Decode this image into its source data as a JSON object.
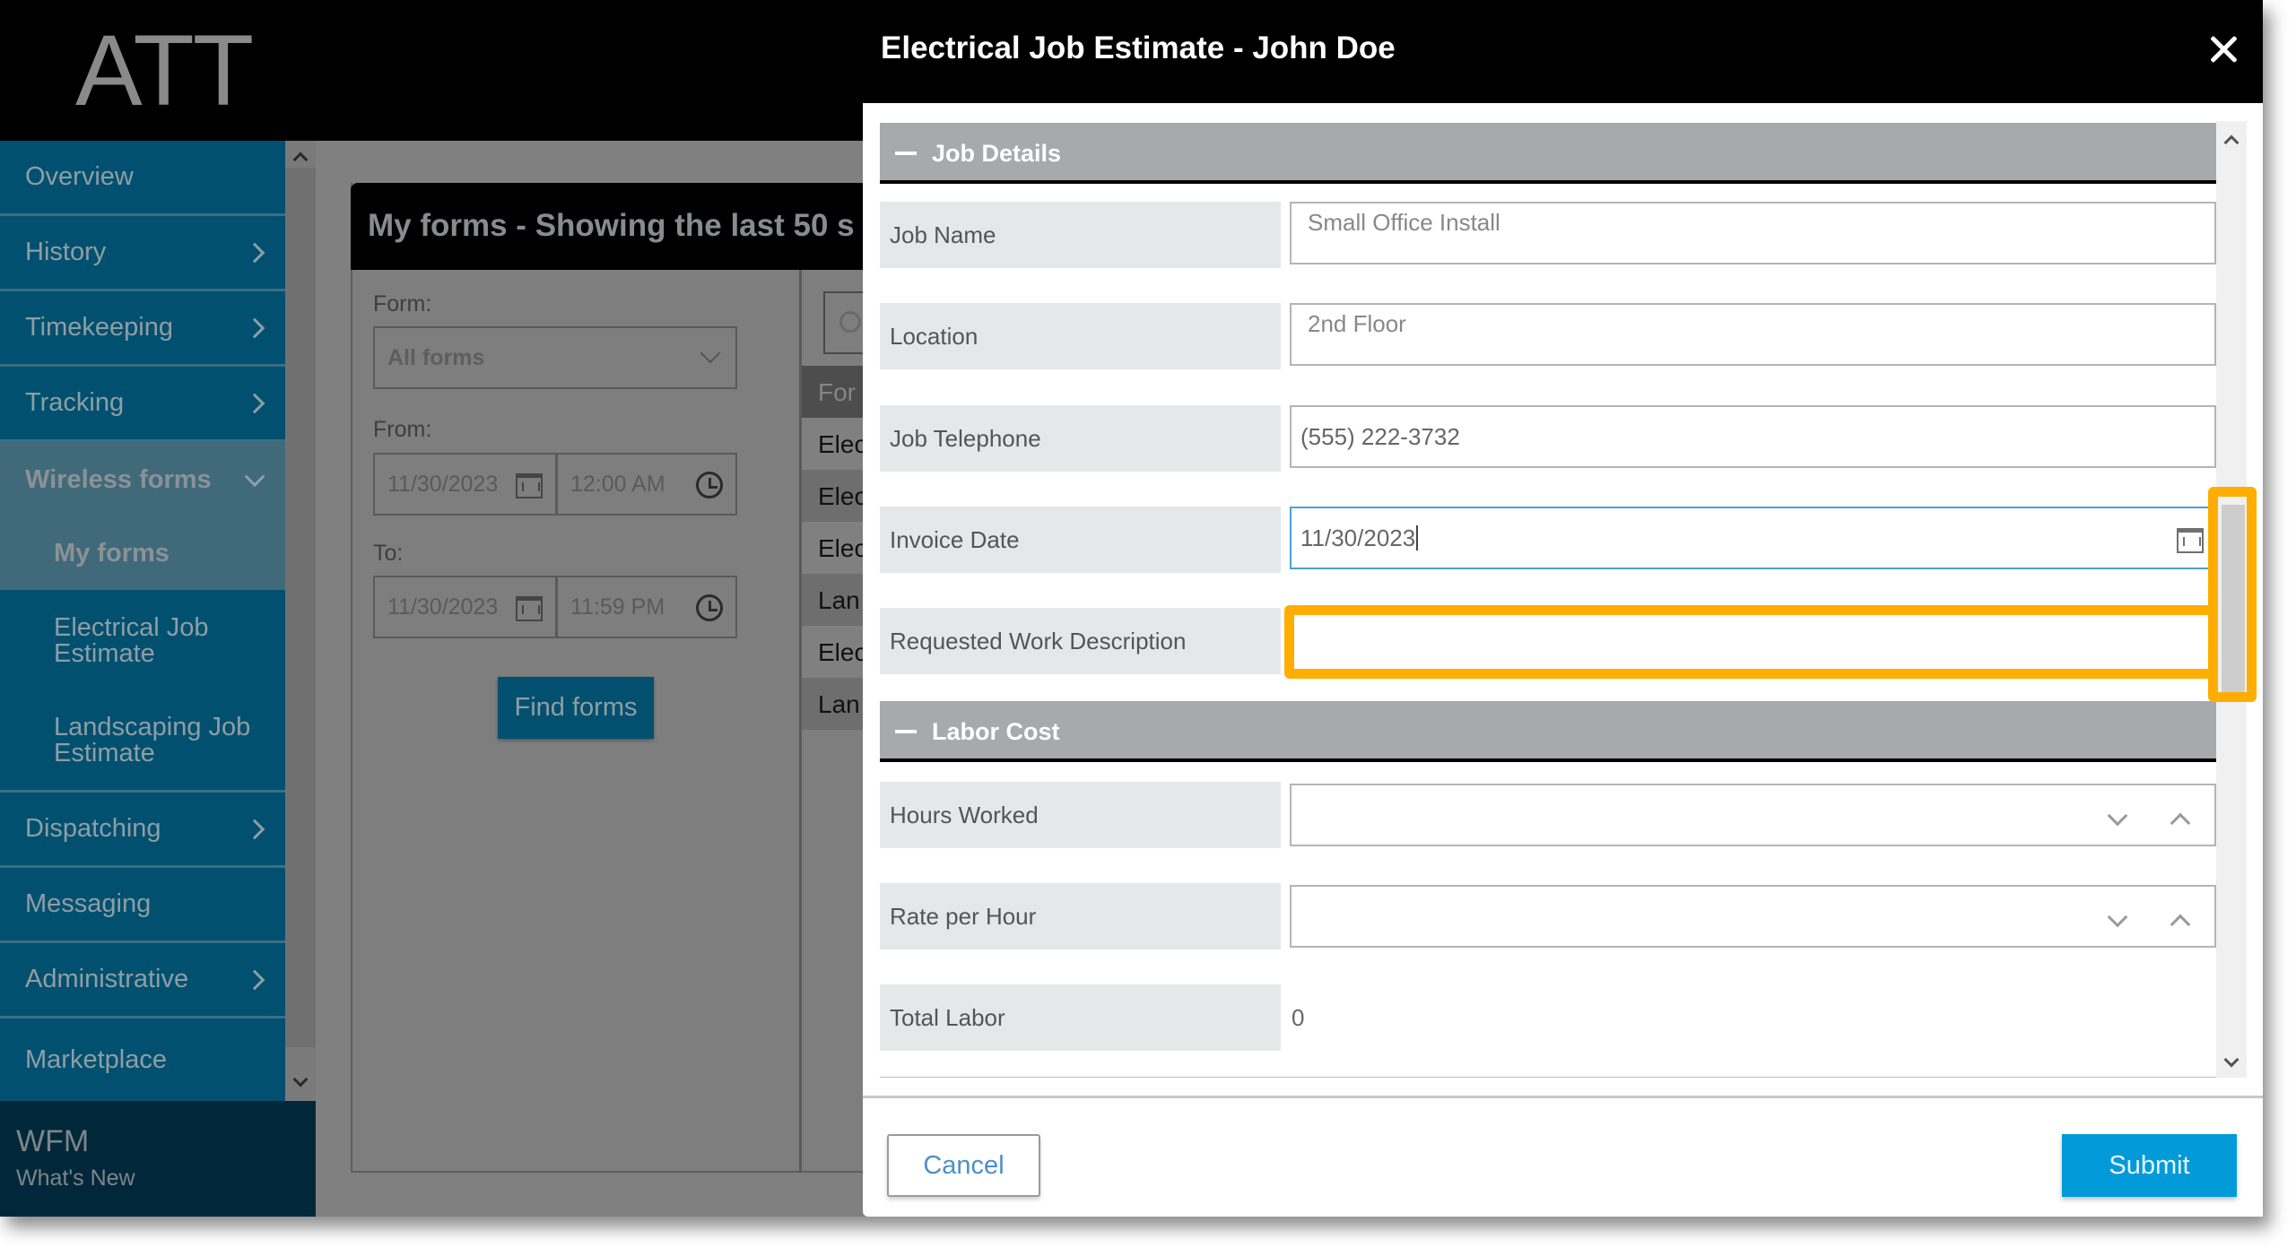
{
  "app": {
    "logo": "ATT",
    "footer_title": "WFM",
    "footer_link": "What's New"
  },
  "sidebar": {
    "items": [
      {
        "label": "Overview",
        "has_chevron": false
      },
      {
        "label": "History",
        "has_chevron": true
      },
      {
        "label": "Timekeeping",
        "has_chevron": true
      },
      {
        "label": "Tracking",
        "has_chevron": true
      },
      {
        "label": "Wireless forms",
        "has_chevron": true,
        "expanded": true
      },
      {
        "label": "Dispatching",
        "has_chevron": true
      },
      {
        "label": "Messaging",
        "has_chevron": false
      },
      {
        "label": "Administrative",
        "has_chevron": true
      },
      {
        "label": "Marketplace",
        "has_chevron": false
      }
    ],
    "sub_items": [
      {
        "label": "My forms",
        "active": true
      },
      {
        "label": "Electrical Job Estimate"
      },
      {
        "label": "Landscaping Job Estimate"
      }
    ]
  },
  "panel": {
    "title": "My forms - Showing the last 50 s",
    "form_label": "Form:",
    "form_value": "All forms",
    "from_label": "From:",
    "from_date": "11/30/2023",
    "from_time": "12:00 AM",
    "to_label": "To:",
    "to_date": "11/30/2023",
    "to_time": "11:59 PM",
    "find_button": "Find forms",
    "list_header": "For",
    "list_rows": [
      "Elec",
      "Elec",
      "Elec",
      "Lan",
      "Elec",
      "Lan"
    ]
  },
  "modal": {
    "title": "Electrical Job Estimate - John Doe",
    "sections": {
      "job_details": {
        "title": "Job Details",
        "fields": {
          "job_name": {
            "label": "Job Name",
            "value": "Small Office Install"
          },
          "location": {
            "label": "Location",
            "value": "2nd Floor"
          },
          "job_telephone": {
            "label": "Job Telephone",
            "value": "(555) 222-3732"
          },
          "invoice_date": {
            "label": "Invoice Date",
            "value": "11/30/2023"
          },
          "requested_work": {
            "label": "Requested Work Description",
            "value": ""
          }
        }
      },
      "labor_cost": {
        "title": "Labor Cost",
        "fields": {
          "hours_worked": {
            "label": "Hours Worked",
            "value": ""
          },
          "rate_per_hour": {
            "label": "Rate per Hour",
            "value": ""
          },
          "total_labor": {
            "label": "Total Labor",
            "value": "0"
          }
        }
      }
    },
    "cancel_label": "Cancel",
    "submit_label": "Submit"
  },
  "colors": {
    "highlight": "#ffad00",
    "submit": "#029ad8",
    "sidebar": "#02506f",
    "focus_border": "#4aa0d6"
  }
}
